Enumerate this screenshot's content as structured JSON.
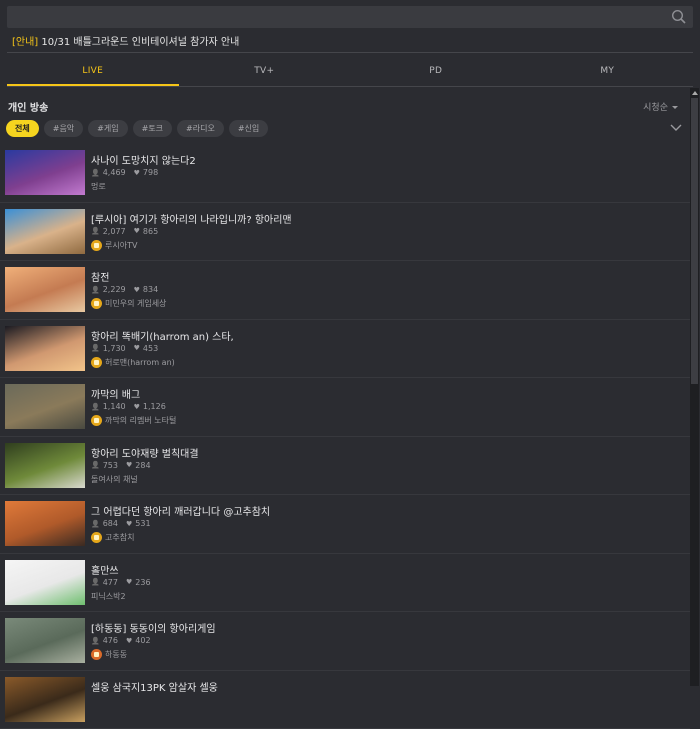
{
  "search": {
    "placeholder": ""
  },
  "notice": {
    "tag": "[안내]",
    "text": " 10/31 배틀그라운드 인비테이셔널 참가자 안내"
  },
  "tabs": [
    {
      "label": "LIVE",
      "active": true
    },
    {
      "label": "TV+",
      "active": false
    },
    {
      "label": "PD",
      "active": false
    },
    {
      "label": "MY",
      "active": false
    }
  ],
  "section": {
    "title": "개인 방송",
    "sort": "시청순"
  },
  "chips": [
    {
      "label": "전체",
      "active": true
    },
    {
      "label": "#음악"
    },
    {
      "label": "#게임"
    },
    {
      "label": "#토크"
    },
    {
      "label": "#라디오"
    },
    {
      "label": "#신입"
    }
  ],
  "colors": {
    "accent": "#f5c518",
    "background": "#2b2c31"
  },
  "streams": [
    {
      "title": "사나이 도망치지 않는다2",
      "viewers": "4,469",
      "likes": "798",
      "owner": "멍로",
      "badge": false,
      "thumb_colors": [
        "#2a3aa0",
        "#7f3f8f",
        "#c27bd0"
      ]
    },
    {
      "title": "[루시아] 여기가 항아리의 나라입니까? 항아리맨",
      "viewers": "2,077",
      "likes": "865",
      "owner": "루시아TV",
      "badge": true,
      "thumb_colors": [
        "#3a8fd6",
        "#d9b28a",
        "#8f6a40"
      ]
    },
    {
      "title": "참전",
      "viewers": "2,229",
      "likes": "834",
      "owner": "미민우의 게임세상",
      "badge": true,
      "thumb_colors": [
        "#f0b07a",
        "#c47b52",
        "#e8c9a2"
      ]
    },
    {
      "title": "항아리 똑배기(harrom an) 스타,",
      "viewers": "1,730",
      "likes": "453",
      "owner": "허로맨(harrom an)",
      "badge": true,
      "thumb_colors": [
        "#1b1b22",
        "#d09870",
        "#f2c48a"
      ]
    },
    {
      "title": "까막의 배그",
      "viewers": "1,140",
      "likes": "1,126",
      "owner": "까막의 리멤버 노타털",
      "badge": true,
      "thumb_colors": [
        "#6b6a5a",
        "#8a7a5a",
        "#4a4a40"
      ]
    },
    {
      "title": "항아리 도야재량 벌칙대결",
      "viewers": "753",
      "likes": "284",
      "owner": "돌여사의 채널",
      "badge": false,
      "thumb_colors": [
        "#2f3e1e",
        "#6f8a3a",
        "#d9d9cf"
      ]
    },
    {
      "title": "그 어렵다던 항아리 깨러갑니다 @고추참치",
      "viewers": "684",
      "likes": "531",
      "owner": "고추참치",
      "badge": true,
      "thumb_colors": [
        "#e07a3a",
        "#b05a2a",
        "#3a2a22"
      ]
    },
    {
      "title": "홀만쓰",
      "viewers": "477",
      "likes": "236",
      "owner": "피닉스박2",
      "badge": false,
      "thumb_colors": [
        "#f5f5f5",
        "#e8e8e8",
        "#6fbf6f"
      ]
    },
    {
      "title": "[하동동] 동동이의 항아리게임",
      "viewers": "476",
      "likes": "402",
      "owner": "하동동",
      "badge": true,
      "badge_orange": true,
      "thumb_colors": [
        "#7a8a7a",
        "#5a6a5a",
        "#a9b0a0"
      ]
    },
    {
      "title": "셀웅 삼국지13PK 암살자 셀웅",
      "viewers": "",
      "likes": "",
      "owner": "",
      "badge": false,
      "thumb_colors": [
        "#8a5a2a",
        "#3a2a1a",
        "#c9a060"
      ]
    }
  ]
}
